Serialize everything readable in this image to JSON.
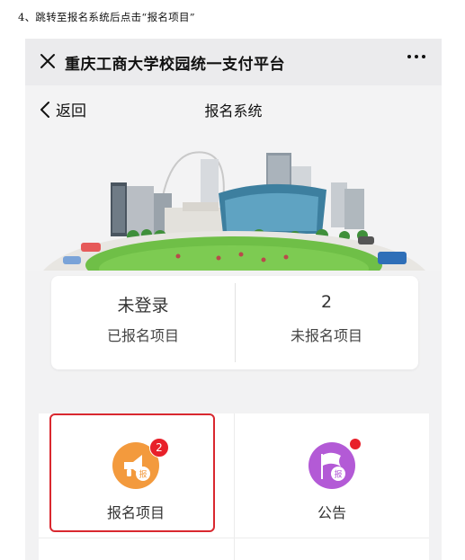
{
  "caption": "4、跳转至报名系统后点击“报名项目”",
  "titlebar": {
    "close_icon": "close-icon",
    "title": "重庆工商大学校园统一支付平台",
    "more_icon": "more-dots-icon"
  },
  "navbar": {
    "back_icon": "chevron-left-icon",
    "back_label": "返回",
    "title": "报名系统"
  },
  "stats": [
    {
      "value": "未登录",
      "label": "已报名项目"
    },
    {
      "value": "2",
      "label": "未报名项目"
    }
  ],
  "menu": [
    {
      "label": "报名项目",
      "icon": "register-megaphone-icon",
      "icon_color": "#f39a3d",
      "badge": "2",
      "highlighted": true
    },
    {
      "label": "公告",
      "icon": "announcement-flag-icon",
      "icon_color": "#b35ad6",
      "badge_dot": true
    }
  ],
  "icon_glyph": "报",
  "colors": {
    "highlight": "#d9282f",
    "badge": "#e8202a"
  }
}
